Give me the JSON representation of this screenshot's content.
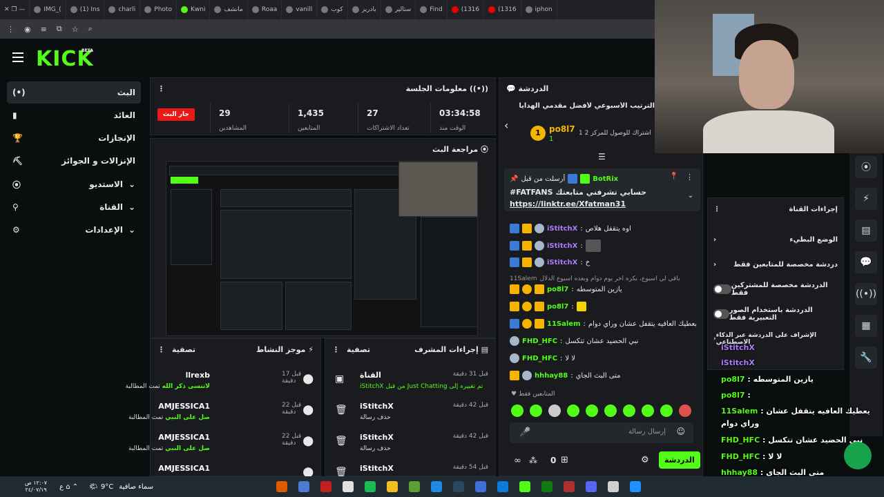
{
  "browser": {
    "tabs": [
      "IMG_(",
      "(1) Ins",
      "charli",
      "Photo",
      "Kwni",
      "مانشف",
      "Roaa",
      "vanill",
      "كوب",
      "بادريز",
      "ستالير",
      "Find",
      "(1316",
      "(1316",
      "iphon"
    ]
  },
  "app": {
    "logo": "KICK",
    "beta": "BETA"
  },
  "sidebar": {
    "items": [
      {
        "label": "البث",
        "icon": "(•)"
      },
      {
        "label": "العائد",
        "icon": "▮"
      },
      {
        "label": "الإنجازات",
        "icon": "🏆"
      },
      {
        "label": "الإنزالات و الجوائز",
        "icon": "⛏"
      },
      {
        "label": "الاستديو",
        "icon": "⦿"
      },
      {
        "label": "القناة",
        "icon": "⚲"
      },
      {
        "label": "الإعدادات",
        "icon": "⚙"
      }
    ]
  },
  "session": {
    "title": "معلومات الجلسة",
    "live_label": "جار البث",
    "stats": [
      {
        "value": "29",
        "label": "المشاهدين"
      },
      {
        "value": "1,435",
        "label": "المتابعين"
      },
      {
        "value": "27",
        "label": "تعداد الاشتراكات"
      },
      {
        "value": "03:34:58",
        "label": "الوقت منذ"
      }
    ]
  },
  "preview": {
    "title": "مراجعة البث"
  },
  "activity": {
    "title": "موجز النشاط",
    "filter": "تصفية",
    "rows": [
      {
        "name": "llrexb",
        "sub_prefix": "تمت المطالبة",
        "sub_highlight": "لاتنسى ذكر الله",
        "time": "قبل 17 دقيقة"
      },
      {
        "name": "AMJESSICA1",
        "sub_prefix": "تمت المطالبة",
        "sub_highlight": "صل على النبي",
        "time": "قبل 22 دقيقة"
      },
      {
        "name": "AMJESSICA1",
        "sub_prefix": "تمت المطالبة",
        "sub_highlight": "صل على النبي",
        "time": "قبل 22 دقيقة"
      },
      {
        "name": "AMJESSICA1",
        "sub_prefix": "",
        "sub_highlight": "",
        "time": ""
      }
    ]
  },
  "mod_actions": {
    "title": "إجراءات المشرف",
    "filter": "تصفية",
    "rows": [
      {
        "name": "القناة",
        "sub": "iStitchX من قبل Just Chatting تم تغييره إلى",
        "time": "قبل 31 دقيقة",
        "icon": "▣"
      },
      {
        "name": "iStitchX",
        "sub": "حذف رسالة",
        "time": "قبل 42 دقيقة",
        "icon": "🗑"
      },
      {
        "name": "iStitchX",
        "sub": "حذف رسالة",
        "time": "قبل 42 دقيقة",
        "icon": "🗑"
      },
      {
        "name": "iStitchX",
        "sub": "حذف رسالة",
        "time": "قبل 54 دقيقة",
        "icon": "🗑"
      }
    ]
  },
  "chat": {
    "title": "الدردشة",
    "leaderboard_title": "الترتيب الأسبوعي لأفضل مقدمي الهدايا",
    "leader_name": "po8l7",
    "leader_count": "1",
    "leader_rank": "1",
    "leader_hint": "1 اشتراك للوصول للمركز 2",
    "pinned_by": "أرسلت من قبل",
    "pinned_user": "BotRix",
    "pinned_text": "#FATFANS حسابي تشرفني متابعتك",
    "pinned_link": "https://linktr.ee/Xfatman31",
    "messages": [
      {
        "user": "iStitchX",
        "text": "اوه يتقفل هلاص",
        "color": "#b07cff"
      },
      {
        "user": "iStitchX",
        "text": "",
        "color": "#b07cff"
      },
      {
        "user": "iStitchX",
        "text": "خ",
        "color": "#b07cff"
      },
      {
        "user": "11Salem",
        "text": "باقي لي اسبوع، بكره اخر يوم دوام وبعده اسبوع الدلال",
        "color": "#999"
      },
      {
        "user": "po8l7",
        "text": "يازين المتوسطه",
        "color": "#53fc18"
      },
      {
        "user": "po8l7",
        "text": "",
        "color": "#53fc18"
      },
      {
        "user": "11Salem",
        "text": "يعطيك العافيه يتقفل عشان وراي دوام",
        "color": "#53fc18"
      },
      {
        "user": "FHD_HFC",
        "text": "نبي الحضيد عشان تتكسل",
        "color": "#53fc18"
      },
      {
        "user": "FHD_HFC",
        "text": "لا لا",
        "color": "#53fc18"
      },
      {
        "user": "hhhay88",
        "text": "متى البث الجاي",
        "color": "#53fc18"
      }
    ],
    "followers_only": "المتابعين فقط",
    "input_placeholder": "إرسال رسالة",
    "send_label": "الدردشة",
    "viewer_count": "0"
  },
  "channel_actions": {
    "title": "إجراءات القناة",
    "rows": [
      {
        "label": "الوضع البطيء",
        "type": "chevron"
      },
      {
        "label": "دردشة مخصصة للمتابعين فقط",
        "type": "chevron"
      },
      {
        "label": "الدردشة مخصصة للمشتركين فقط",
        "type": "toggle"
      },
      {
        "label": "الدردشة باستخدام الصور التعبيرية فقط",
        "type": "toggle"
      },
      {
        "label": "الإشراف على الدردشة عبر الذكاء الاصطناعي",
        "type": "chevron"
      }
    ]
  },
  "overlay_chat": [
    {
      "user": "iStitchX",
      "text": ""
    },
    {
      "user": "iStitchX",
      "text": ""
    },
    {
      "user": "po8l7",
      "text": "يازين المتوسطه"
    },
    {
      "user": "po8l7",
      "text": ""
    },
    {
      "user": "11Salem",
      "text": "يعطيك العافيه يتقفل عشان"
    },
    {
      "user": "",
      "text": "وراي دوام"
    },
    {
      "user": "FHD_HFC",
      "text": "نبي الحضيد عشان تتكسل"
    },
    {
      "user": "FHD_HFC",
      "text": "لا لا"
    },
    {
      "user": "hhhay88",
      "text": "متى البث الجاي"
    }
  ],
  "taskbar": {
    "weather_temp": "9°C",
    "weather_text": "سماء صافية",
    "time": "١٢:٠٧ ص",
    "date": "٢٤/٠٧/١٩"
  },
  "colors": {
    "accent": "#53fc18",
    "live": "#e91916",
    "panel": "#191b1f"
  }
}
